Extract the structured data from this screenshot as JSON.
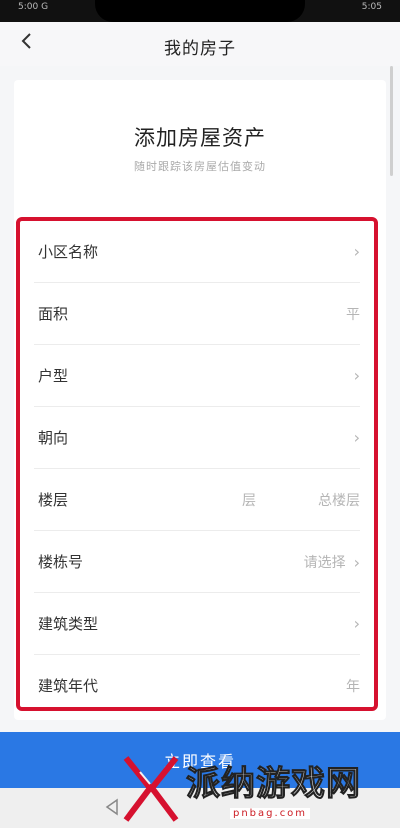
{
  "status_bar": {
    "left": "5:00 G",
    "right": "5:05"
  },
  "nav": {
    "title": "我的房子",
    "back_icon": "back-arrow-icon"
  },
  "header": {
    "title": "添加房屋资产",
    "subtitle": "随时跟踪该房屋估值变动"
  },
  "form": {
    "rows": [
      {
        "label": "小区名称",
        "value": "",
        "has_chevron": true
      },
      {
        "label": "面积",
        "value": "平",
        "has_chevron": false
      },
      {
        "label": "户型",
        "value": "",
        "has_chevron": true
      },
      {
        "label": "朝向",
        "value": "",
        "has_chevron": true
      },
      {
        "label": "楼层",
        "mid": "层",
        "value": "总楼层",
        "has_chevron": false
      },
      {
        "label": "楼栋号",
        "value": "请选择",
        "has_chevron": true
      },
      {
        "label": "建筑类型",
        "value": "",
        "has_chevron": true
      },
      {
        "label": "建筑年代",
        "value": "年",
        "has_chevron": false
      }
    ]
  },
  "submit": {
    "label": "立即查看"
  },
  "watermark": {
    "text": "派纳游戏网",
    "url": "pnbag.com"
  },
  "colors": {
    "highlight_border": "#d6112f",
    "primary": "#2a78e4"
  }
}
